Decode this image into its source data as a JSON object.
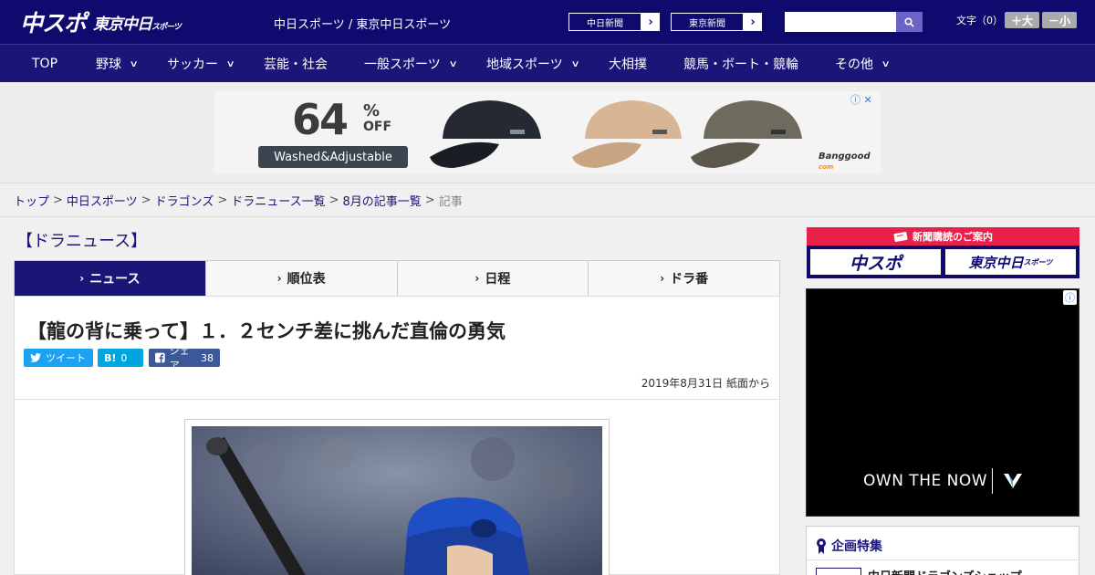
{
  "header": {
    "logo_main": "中スポ",
    "logo_sub": "東京中日",
    "logo_sub_small": "スポーツ",
    "site_title": "中日スポーツ / 東京中日スポーツ",
    "paper_links": [
      "中日新聞",
      "東京新聞"
    ],
    "search": {
      "placeholder": ""
    },
    "font_size_label": "文字（0）",
    "font_larger": "＋大",
    "font_smaller": "－小"
  },
  "nav": {
    "items": [
      {
        "label": "TOP",
        "dropdown": false
      },
      {
        "label": "野球",
        "dropdown": true
      },
      {
        "label": "サッカー",
        "dropdown": true
      },
      {
        "label": "芸能・社会",
        "dropdown": false
      },
      {
        "label": "一般スポーツ",
        "dropdown": true
      },
      {
        "label": "地域スポーツ",
        "dropdown": true
      },
      {
        "label": "大相撲",
        "dropdown": false
      },
      {
        "label": "競馬・ボート・競輪",
        "dropdown": false
      },
      {
        "label": "その他",
        "dropdown": true
      }
    ]
  },
  "ad_banner": {
    "percent": "64",
    "percent_suffix": "%",
    "off_label": "OFF",
    "tagline": "Washed&Adjustable",
    "brand": "Banggood",
    "brand_sub": "com"
  },
  "breadcrumb": {
    "links": [
      "トップ",
      "中日スポーツ",
      "ドラゴンズ",
      "ドラニュース一覧",
      "8月の記事一覧"
    ],
    "current": "記事",
    "separator": ">"
  },
  "section": {
    "title": "【ドラニュース】"
  },
  "tabs": [
    {
      "label": "ニュース",
      "active": true
    },
    {
      "label": "順位表",
      "active": false
    },
    {
      "label": "日程",
      "active": false
    },
    {
      "label": "ドラ番",
      "active": false
    }
  ],
  "article": {
    "headline": "【龍の背に乗って】１．２センチ差に挑んだ直倫の勇気",
    "share": {
      "tweet_label": "ツイート",
      "hatena_label": "B!",
      "hatena_count": "0",
      "facebook_label": "シェア",
      "facebook_count": "38"
    },
    "date": "2019年8月31日 紙面から"
  },
  "sidebar": {
    "subscription_title": "新聞購読のご案内",
    "subscription_buttons": [
      "中スポ",
      "東京中日"
    ],
    "subscription_button_small": "スポーツ",
    "ad_text": "OWN THE NOW",
    "feature_title": "企画特集",
    "feature_item": "中日新聞ドラゴンズショップ"
  },
  "colors": {
    "brand_navy": "#0f0a6e",
    "nav_bg": "#1b1577",
    "accent_red": "#e8204a",
    "twitter": "#1da1f2",
    "hatena": "#00a4de",
    "facebook": "#3b5998"
  }
}
